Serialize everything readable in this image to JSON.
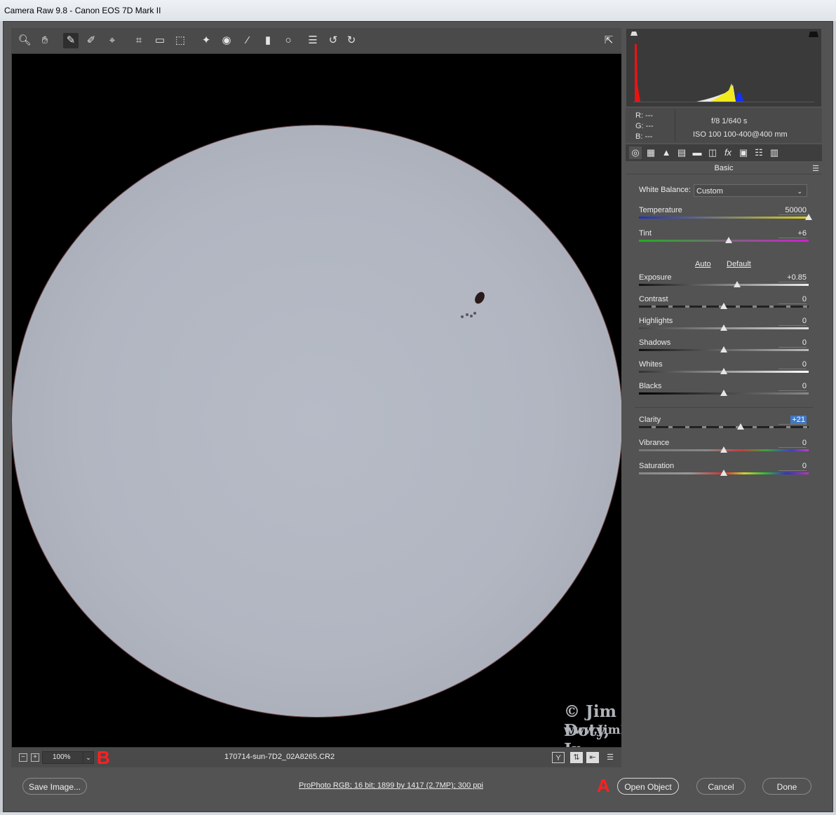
{
  "window": {
    "title": "Camera Raw 9.8  -  Canon EOS 7D Mark II"
  },
  "toolbar": {
    "tools": [
      {
        "name": "zoom-tool-icon",
        "glyph": "🔍︎"
      },
      {
        "name": "hand-tool-icon",
        "glyph": "✋︎"
      },
      {
        "name": "white-balance-tool-icon",
        "glyph": "✎"
      },
      {
        "name": "color-sampler-tool-icon",
        "glyph": "✐"
      },
      {
        "name": "targeted-adjustment-tool-icon",
        "glyph": "⌖"
      },
      {
        "name": "crop-tool-icon",
        "glyph": "⌗"
      },
      {
        "name": "straighten-tool-icon",
        "glyph": "▭"
      },
      {
        "name": "transform-tool-icon",
        "glyph": "⬚"
      },
      {
        "name": "spot-removal-tool-icon",
        "glyph": "✦"
      },
      {
        "name": "red-eye-removal-icon",
        "glyph": "◉"
      },
      {
        "name": "adjustment-brush-icon",
        "glyph": "⁄"
      },
      {
        "name": "graduated-filter-icon",
        "glyph": "▮"
      },
      {
        "name": "radial-filter-icon",
        "glyph": "○"
      },
      {
        "name": "preferences-icon",
        "glyph": "☰"
      },
      {
        "name": "rotate-ccw-icon",
        "glyph": "↺"
      },
      {
        "name": "rotate-cw-icon",
        "glyph": "↻"
      }
    ],
    "fullscreen_glyph": "⇱"
  },
  "preview": {
    "watermark_line1": "© Jim Doty, Jr.",
    "watermark_line2": "www.JimDoty.com"
  },
  "statusbar": {
    "zoom_out": "−",
    "zoom_in": "+",
    "zoom_value": "100%",
    "zoom_arrow": "⌄",
    "marker_b": "B",
    "filename": "170714-sun-7D2_02A8265.CR2",
    "icon_y": "Y",
    "icon_before_after": "⇅",
    "icon_swap": "⇤",
    "icon_settings": "☰"
  },
  "readout": {
    "r": "R:   ---",
    "g": "G:   ---",
    "b": "B:   ---",
    "exif_line1": "f/8    1/640 s",
    "exif_line2": "ISO 100    100-400@400 mm"
  },
  "panel": {
    "title": "Basic",
    "menu_glyph": "☰",
    "tab_glyphs": [
      "◎",
      "▦",
      "▲",
      "▤",
      "▬",
      "◫",
      "fx",
      "▣",
      "☷",
      "▥"
    ],
    "white_balance_label": "White Balance:",
    "white_balance_value": "Custom",
    "white_balance_arrow": "⌄",
    "auto_label": "Auto",
    "default_label": "Default",
    "sliders": [
      {
        "key": "temperature",
        "label": "Temperature",
        "value": "50000",
        "pos": 1.0
      },
      {
        "key": "tint",
        "label": "Tint",
        "value": "+6",
        "pos": 0.53
      },
      {
        "key": "exposure",
        "label": "Exposure",
        "value": "+0.85",
        "pos": 0.58
      },
      {
        "key": "contrast",
        "label": "Contrast",
        "value": "0",
        "pos": 0.5
      },
      {
        "key": "highlights",
        "label": "Highlights",
        "value": "0",
        "pos": 0.5
      },
      {
        "key": "shadows",
        "label": "Shadows",
        "value": "0",
        "pos": 0.5
      },
      {
        "key": "whites",
        "label": "Whites",
        "value": "0",
        "pos": 0.5
      },
      {
        "key": "blacks",
        "label": "Blacks",
        "value": "0",
        "pos": 0.5
      },
      {
        "key": "clarity",
        "label": "Clarity",
        "value": "+21",
        "pos": 0.6
      },
      {
        "key": "vibrance",
        "label": "Vibrance",
        "value": "0",
        "pos": 0.5
      },
      {
        "key": "saturation",
        "label": "Saturation",
        "value": "0",
        "pos": 0.5
      }
    ]
  },
  "bottom": {
    "save_image": "Save Image...",
    "image_info": "ProPhoto RGB; 16 bit; 1899 by 1417 (2.7MP); 300 ppi",
    "marker_a": "A",
    "open_object": "Open Object",
    "cancel": "Cancel",
    "done": "Done"
  },
  "colors": {
    "panel_bg": "#535353",
    "highlight": "#3f78c4",
    "marker": "#ff2020"
  }
}
